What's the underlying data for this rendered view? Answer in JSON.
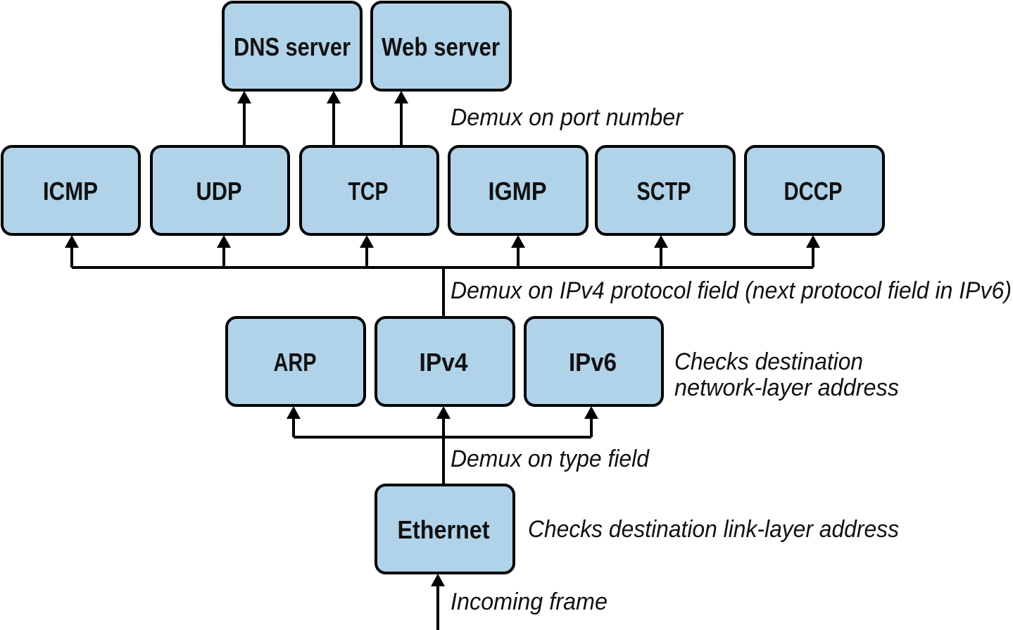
{
  "diagram": {
    "box_fill": "#b1d3e9",
    "servers": [
      "DNS server",
      "Web server"
    ],
    "transport": [
      "ICMP",
      "UDP",
      "TCP",
      "IGMP",
      "SCTP",
      "DCCP"
    ],
    "network": [
      "ARP",
      "IPv4",
      "IPv6"
    ],
    "link": "Ethernet",
    "notes": {
      "port": "Demux on port number",
      "protocol": "Demux on IPv4 protocol field (next protocol field in IPv6)",
      "network_check_1": "Checks destination",
      "network_check_2": "network-layer address",
      "type": "Demux on type field",
      "link_check": "Checks destination link-layer address",
      "incoming": "Incoming frame"
    }
  }
}
